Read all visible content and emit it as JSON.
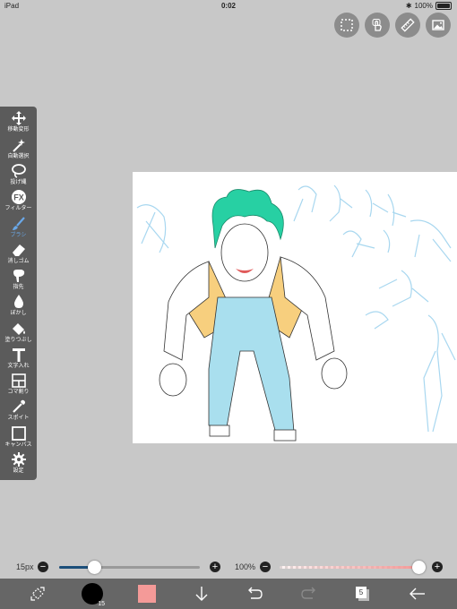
{
  "status": {
    "device": "iPad",
    "time": "0:02",
    "battery": "100%"
  },
  "tools": [
    {
      "label": "移動変形",
      "icon": "move-icon"
    },
    {
      "label": "自動選択",
      "icon": "magic-wand-icon"
    },
    {
      "label": "投げ縄",
      "icon": "lasso-icon"
    },
    {
      "label": "フィルター",
      "icon": "fx-icon"
    },
    {
      "label": "ブラシ",
      "icon": "brush-icon"
    },
    {
      "label": "消しゴム",
      "icon": "eraser-icon"
    },
    {
      "label": "指先",
      "icon": "finger-icon"
    },
    {
      "label": "ぼかし",
      "icon": "blur-drop-icon"
    },
    {
      "label": "塗りつぶし",
      "icon": "fill-bucket-icon"
    },
    {
      "label": "文字入れ",
      "icon": "text-icon"
    },
    {
      "label": "コマ割り",
      "icon": "frame-divide-icon"
    },
    {
      "label": "スポイト",
      "icon": "eyedropper-icon"
    },
    {
      "label": "キャンバス",
      "icon": "canvas-icon"
    },
    {
      "label": "設定",
      "icon": "gear-icon"
    }
  ],
  "active_tool": "ブラシ",
  "brush_size": {
    "value": "15px",
    "level": 0.25
  },
  "opacity": {
    "value": "100%",
    "level": 1.0
  },
  "bottom": {
    "brush_preview_size": "15",
    "layer_count": "5",
    "color": "#f49a98"
  },
  "colors": {
    "accent": "#1c4f7a",
    "toolbar": "#5b5b5b",
    "active": "#6aa8e8"
  }
}
